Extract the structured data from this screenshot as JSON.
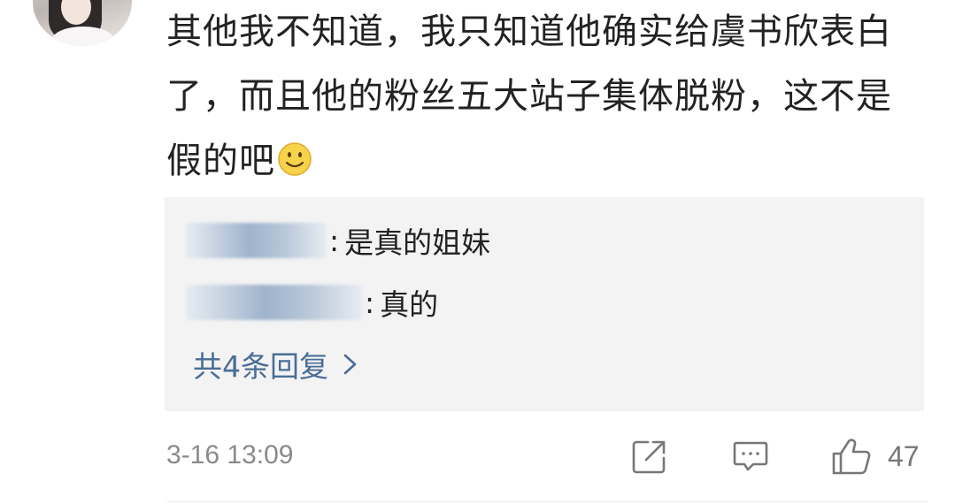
{
  "comment": {
    "text": "其他我不知道，我只知道他确实给虞书欣表白了，而且他的粉丝五大站子集体脱粉，这不是假的吧",
    "emoji": "smile-emoji"
  },
  "replies": [
    {
      "text": "是真的姐妹"
    },
    {
      "text": "真的"
    }
  ],
  "reply_summary": {
    "label": "共4条回复"
  },
  "meta": {
    "timestamp": "3-16 13:09"
  },
  "actions": {
    "like_count": "47"
  },
  "colors": {
    "link": "#4a6d96",
    "reply_bg": "#f3f3f3",
    "meta": "#8a8a8a",
    "text": "#222222"
  }
}
